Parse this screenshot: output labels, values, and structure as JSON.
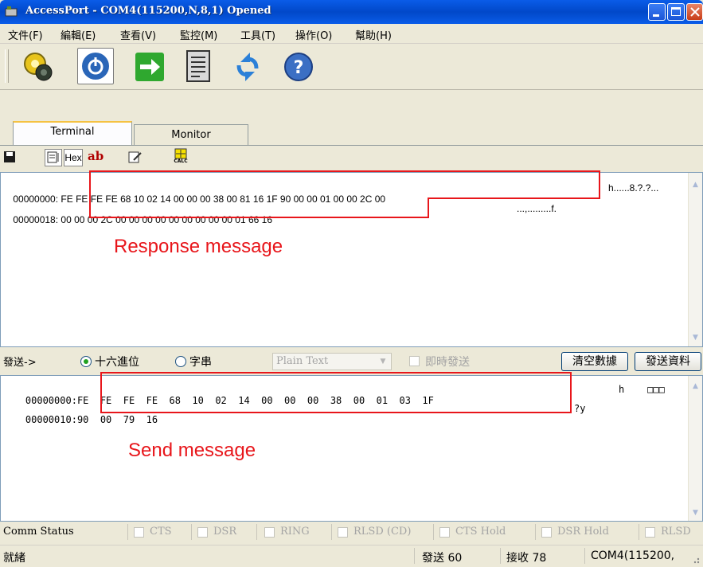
{
  "window": {
    "title": "AccessPort - COM4(115200,N,8,1) Opened"
  },
  "menu": [
    "文件(F)",
    "編輯(E)",
    "查看(V)",
    "監控(M)",
    "工具(T)",
    "操作(O)",
    "幫助(H)"
  ],
  "toolbar": [
    "settings-gear-icon",
    "power-icon",
    "send-arrow-icon",
    "document-icon",
    "refresh-icon",
    "help-icon"
  ],
  "tabs": {
    "terminal": "Terminal",
    "monitor": "Monitor"
  },
  "subtoolbar": {
    "hex": "Hex",
    "ab": "ab",
    "calc": "CALC"
  },
  "response": {
    "rows": [
      {
        "addr": "00000000:",
        "hex": "FE FE FE FE 68 10 02 14 00 00 00 38 00 81 16 1F 90 00 00 01 00 00 2C 00",
        "ascii": "h......8.?.?..."
      },
      {
        "addr": "00000018:",
        "hex": "00 00 00 2C 00 00 00 00 00 00 00 00 00 01 66 16",
        "ascii": "...,.........f."
      }
    ],
    "annotation": "Response message"
  },
  "sendbar": {
    "label": "發送->",
    "radio_hex": "十六進位",
    "radio_string": "字串",
    "mode_select": "Plain Text",
    "realtime_label": "即時發送",
    "clear_button": "清空數據",
    "send_button": "發送資料"
  },
  "send": {
    "rows": [
      {
        "addr": "00000000:",
        "hex": "FE  FE  FE  FE  68  10  02  14  00  00  00  38  00  01  03  1F",
        "ascii": "h    □□□"
      },
      {
        "addr": "00000010:",
        "hex": "90  00  79  16",
        "ascii": "?y"
      }
    ],
    "annotation": "Send message"
  },
  "comm_status": {
    "label": "Comm Status",
    "signals": [
      "CTS",
      "DSR",
      "RING",
      "RLSD (CD)",
      "CTS Hold",
      "DSR Hold",
      "RLSD"
    ]
  },
  "statusbar": {
    "ready": "就緒",
    "sent": "發送 60",
    "received": "接收 78",
    "port": "COM4(115200,"
  }
}
